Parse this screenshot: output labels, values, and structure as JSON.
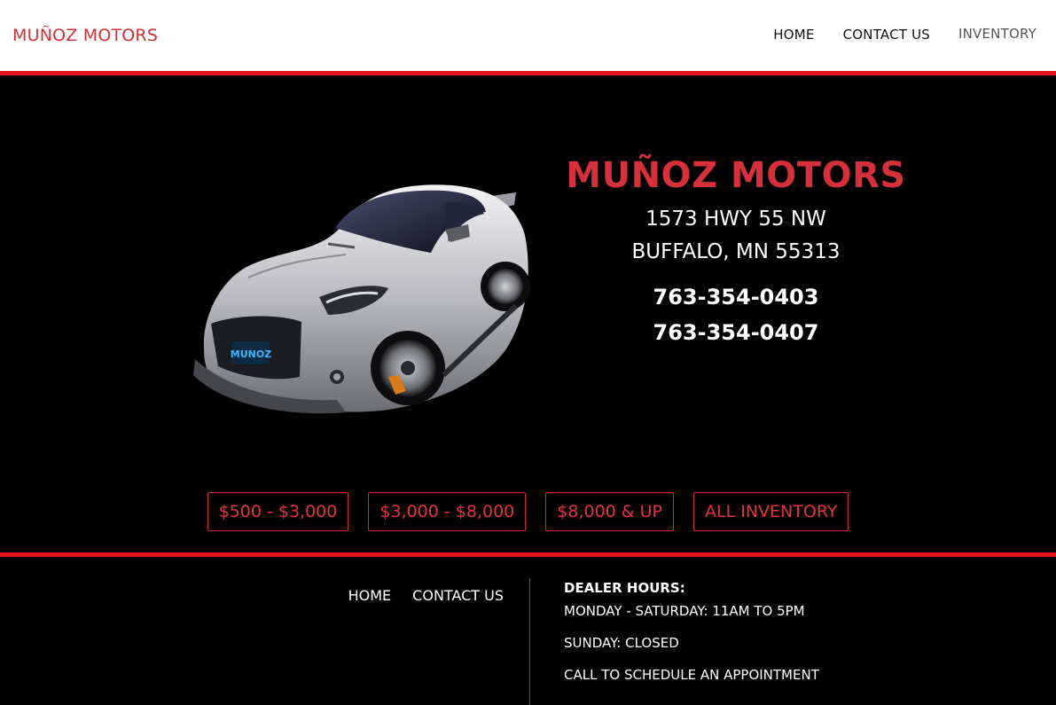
{
  "header": {
    "brand": "MUÑOZ MOTORS",
    "nav": [
      "HOME",
      "CONTACT US",
      "INVENTORY"
    ]
  },
  "hero": {
    "title": "MUÑOZ MOTORS",
    "address_line1": "1573 HWY 55 NW",
    "address_line2": "BUFFALO, MN 55313",
    "phone1": "763-354-0403",
    "phone2": "763-354-0407",
    "car_plate": "MUNOZ"
  },
  "price_buttons": [
    "$500 - $3,000",
    "$3,000 - $8,000",
    "$8,000 & UP",
    "ALL INVENTORY"
  ],
  "footer": {
    "nav": [
      "HOME",
      "CONTACT US"
    ],
    "hours_title": "DEALER HOURS:",
    "hours": [
      "MONDAY - SATURDAY: 11AM TO 5PM",
      "SUNDAY: CLOSED",
      "CALL TO SCHEDULE AN APPOINTMENT"
    ]
  },
  "colors": {
    "accent": "#d6303c",
    "redline": "#e8141c",
    "background": "#000000"
  }
}
